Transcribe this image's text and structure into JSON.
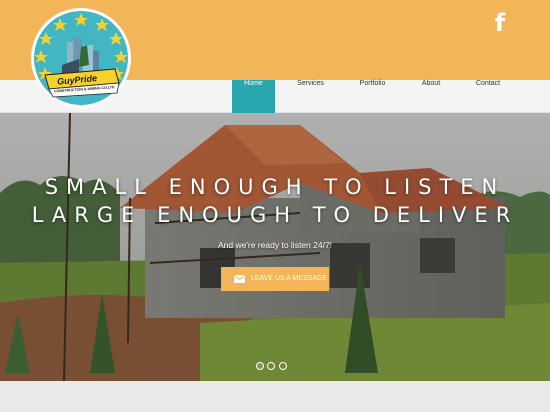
{
  "brand": {
    "name": "GuyPride",
    "subtitle": "CONSTRUCTION & MINING CO.LTD"
  },
  "social": {
    "facebook_icon": "facebook-icon",
    "facebook_glyph": "f"
  },
  "nav": {
    "items": [
      {
        "label": "Home",
        "active": true
      },
      {
        "label": "Services",
        "active": false
      },
      {
        "label": "Portfolio",
        "active": false
      },
      {
        "label": "About",
        "active": false
      },
      {
        "label": "Contact",
        "active": false
      }
    ]
  },
  "hero": {
    "headline_line1": "SMALL ENOUGH TO LISTEN",
    "headline_line2": "LARGE ENOUGH TO DELIVER",
    "tagline": "And we're ready to listen 24/7!",
    "cta_label": "LEAVE US A MESSAGE",
    "cta_icon": "envelope-icon",
    "slides": 3,
    "active_slide": 1
  },
  "colors": {
    "accent": "#f2b558",
    "nav_active": "#2aa6ad",
    "logo_circle": "#43b6c4",
    "logo_stars": "#f7d22a",
    "roof": "#b8623c"
  }
}
